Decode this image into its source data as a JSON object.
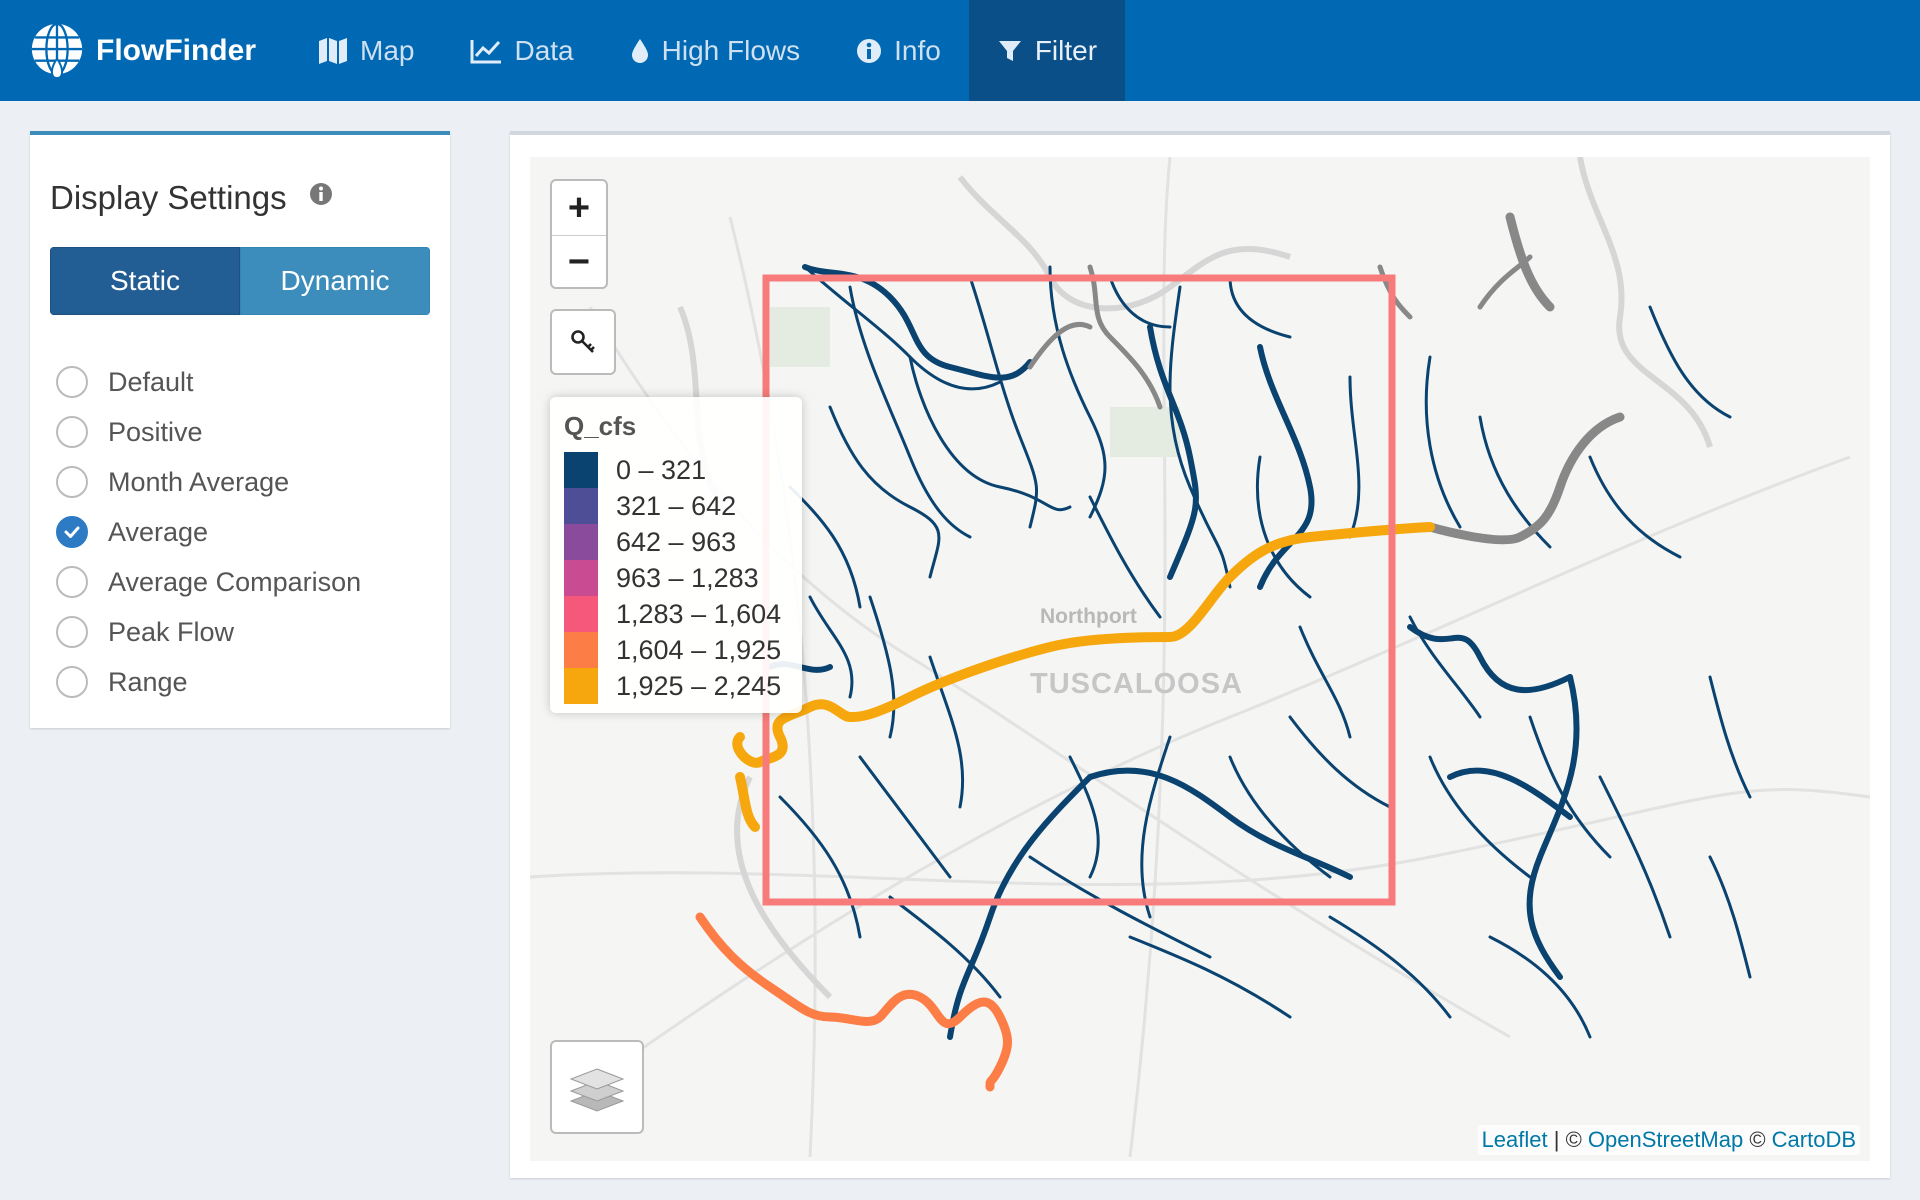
{
  "brand": {
    "name": "FlowFinder"
  },
  "nav": {
    "items": [
      {
        "label": "Map",
        "icon": "map-icon"
      },
      {
        "label": "Data",
        "icon": "chart-line-icon"
      },
      {
        "label": "High Flows",
        "icon": "droplet-icon"
      },
      {
        "label": "Info",
        "icon": "info-circle-icon"
      },
      {
        "label": "Filter",
        "icon": "filter-icon",
        "active": true
      }
    ]
  },
  "sidebar": {
    "title": "Display Settings",
    "toggle": {
      "static": "Static",
      "dynamic": "Dynamic",
      "selected": "Static"
    },
    "options": [
      {
        "label": "Default",
        "checked": false
      },
      {
        "label": "Positive",
        "checked": false
      },
      {
        "label": "Month Average",
        "checked": false
      },
      {
        "label": "Average",
        "checked": true
      },
      {
        "label": "Average Comparison",
        "checked": false
      },
      {
        "label": "Peak Flow",
        "checked": false
      },
      {
        "label": "Range",
        "checked": false
      }
    ]
  },
  "map": {
    "zoom_in": "+",
    "zoom_out": "−",
    "city_labels": {
      "northport": "Northport",
      "tuscaloosa": "TUSCALOOSA"
    },
    "legend": {
      "title": "Q_cfs",
      "entries": [
        {
          "label": "0 – 321",
          "color": "#0a4370"
        },
        {
          "label": "321 – 642",
          "color": "#4d4e95"
        },
        {
          "label": "642 – 963",
          "color": "#8a4b9d"
        },
        {
          "label": "963 – 1,283",
          "color": "#c94b92"
        },
        {
          "label": "1,283 – 1,604",
          "color": "#f5587a"
        },
        {
          "label": "1,604 – 1,925",
          "color": "#fc7d46"
        },
        {
          "label": "1,925 – 2,245",
          "color": "#f7a70e"
        }
      ]
    },
    "attribution": {
      "leaflet": "Leaflet",
      "sep1": " | © ",
      "osm": "OpenStreetMap",
      "sep2": " © ",
      "carto": "CartoDB"
    },
    "colors": {
      "bbox": "#f77b7b",
      "low_flow": "#0a4370",
      "no_data": "#888888",
      "high_flow": "#f7a70e",
      "mid_high_flow": "#fc7d46"
    }
  }
}
